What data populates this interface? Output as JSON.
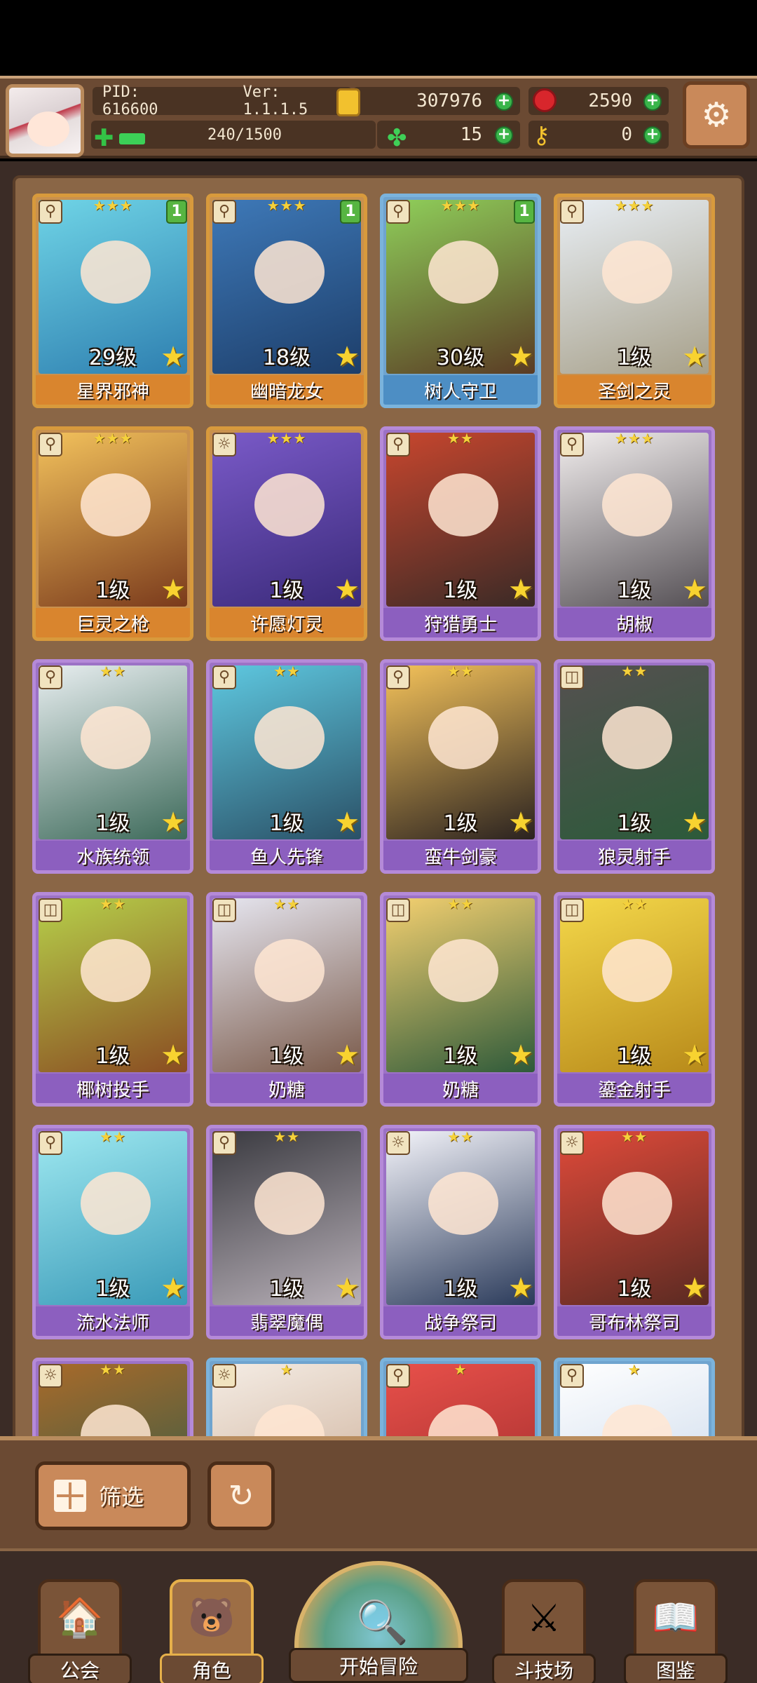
{
  "header": {
    "pid": "PID: 616600",
    "version": "Ver: 1.1.1.5",
    "coins": "307976",
    "gems": "2590",
    "stamina": "240/1500",
    "clovers": "15",
    "keys": "0",
    "stamina_fraction": 0.16
  },
  "cards": [
    {
      "name": "星界邪神",
      "level": "29级",
      "stars": "★★★",
      "badge": "1",
      "frame": "gold"
    },
    {
      "name": "幽暗龙女",
      "level": "18级",
      "stars": "★★★",
      "badge": "1",
      "frame": "gold"
    },
    {
      "name": "树人守卫",
      "level": "30级",
      "stars": "★★★",
      "badge": "1",
      "frame": "blue"
    },
    {
      "name": "圣剑之灵",
      "level": "1级",
      "stars": "★★★",
      "badge": "",
      "frame": "gold"
    },
    {
      "name": "巨灵之枪",
      "level": "1级",
      "stars": "★★★",
      "badge": "",
      "frame": "gold"
    },
    {
      "name": "许愿灯灵",
      "level": "1级",
      "stars": "★★★",
      "badge": "",
      "frame": "gold"
    },
    {
      "name": "狩猎勇士",
      "level": "1级",
      "stars": "★★",
      "badge": "",
      "frame": "purple"
    },
    {
      "name": "胡椒",
      "level": "1级",
      "stars": "★★★",
      "badge": "",
      "frame": "purple"
    },
    {
      "name": "水族统领",
      "level": "1级",
      "stars": "★★",
      "badge": "",
      "frame": "purple"
    },
    {
      "name": "鱼人先锋",
      "level": "1级",
      "stars": "★★",
      "badge": "",
      "frame": "purple"
    },
    {
      "name": "蛮牛剑豪",
      "level": "1级",
      "stars": "★★",
      "badge": "",
      "frame": "purple"
    },
    {
      "name": "狼灵射手",
      "level": "1级",
      "stars": "★★",
      "badge": "",
      "frame": "purple"
    },
    {
      "name": "椰树投手",
      "level": "1级",
      "stars": "★★",
      "badge": "",
      "frame": "purple"
    },
    {
      "name": "奶糖",
      "level": "1级",
      "stars": "★★",
      "badge": "",
      "frame": "purple"
    },
    {
      "name": "奶糖",
      "level": "1级",
      "stars": "★★",
      "badge": "",
      "frame": "purple"
    },
    {
      "name": "鎏金射手",
      "level": "1级",
      "stars": "★★",
      "badge": "",
      "frame": "purple"
    },
    {
      "name": "流水法师",
      "level": "1级",
      "stars": "★★",
      "badge": "",
      "frame": "purple"
    },
    {
      "name": "翡翠魔偶",
      "level": "1级",
      "stars": "★★",
      "badge": "",
      "frame": "purple"
    },
    {
      "name": "战争祭司",
      "level": "1级",
      "stars": "★★",
      "badge": "",
      "frame": "purple"
    },
    {
      "name": "哥布林祭司",
      "level": "1级",
      "stars": "★★",
      "badge": "",
      "frame": "purple"
    },
    {
      "name": "",
      "level": "",
      "stars": "★★",
      "badge": "",
      "frame": "purple"
    },
    {
      "name": "",
      "level": "",
      "stars": "★",
      "badge": "",
      "frame": "blue"
    },
    {
      "name": "",
      "level": "",
      "stars": "★",
      "badge": "",
      "frame": "blue"
    },
    {
      "name": "",
      "level": "",
      "stars": "★",
      "badge": "",
      "frame": "blue"
    }
  ],
  "panel": {
    "filter_label": "筛选"
  },
  "nav": {
    "guild": "公会",
    "character": "角色",
    "adventure": "开始冒险",
    "arena": "斗技场",
    "codex": "图鉴"
  },
  "colors": {
    "wood": "#6b4a33",
    "gold_frame": "#d89a3c",
    "blue_frame": "#7bb3dc",
    "purple_frame": "#b58ad8",
    "plus_green": "#39b54a"
  },
  "icons": {
    "settings": "gear-icon",
    "coin": "coin-icon",
    "gem": "gem-icon",
    "clover": "clover-icon",
    "key": "key-icon",
    "filter": "grid-icon",
    "reset": "refresh-icon"
  }
}
